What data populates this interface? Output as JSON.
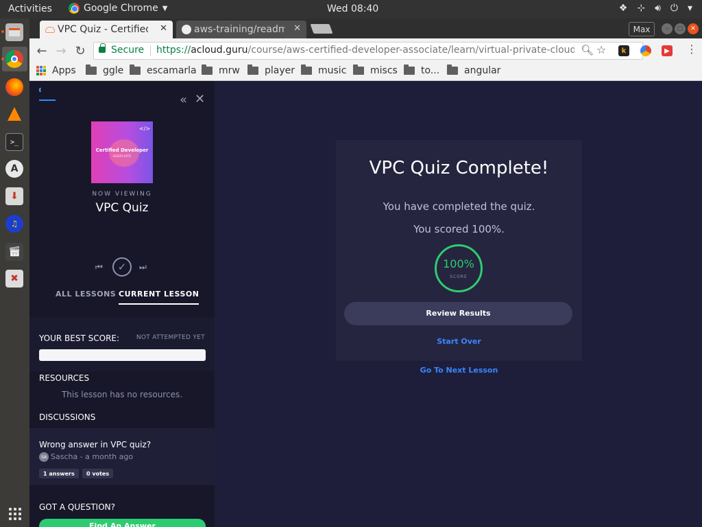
{
  "topbar": {
    "activities": "Activities",
    "app_name": "Google Chrome",
    "clock": "Wed 08:40"
  },
  "chrome": {
    "tabs": [
      {
        "title": "VPC Quiz - Certified",
        "active": true
      },
      {
        "title": "aws-training/readme",
        "active": false
      }
    ],
    "max_label": "Max",
    "secure_label": "Secure",
    "url_scheme": "https://",
    "url_host": "acloud.guru",
    "url_path": "/course/aws-certified-developer-associate/learn/virtual-private-cloud/quiz/..."
  },
  "bookmarks": [
    {
      "label": "Apps",
      "icon": "apps-grid-icon"
    },
    {
      "label": "ggle",
      "icon": "folder-icon"
    },
    {
      "label": "escamarla",
      "icon": "folder-icon"
    },
    {
      "label": "mrw",
      "icon": "folder-icon"
    },
    {
      "label": "player",
      "icon": "folder-icon"
    },
    {
      "label": "music",
      "icon": "folder-icon"
    },
    {
      "label": "miscs",
      "icon": "folder-icon"
    },
    {
      "label": "to...",
      "icon": "folder-icon"
    },
    {
      "label": "angular",
      "icon": "folder-icon"
    }
  ],
  "sidebar": {
    "thumbnail_title": "Certified Developer",
    "thumbnail_subtitle": "ASSOCIATE",
    "now_viewing_label": "NOW VIEWING",
    "lesson_title": "VPC Quiz",
    "tab_all": "ALL LESSONS",
    "tab_current": "CURRENT LESSON",
    "best_score_label": "YOUR BEST SCORE:",
    "best_score_status": "NOT ATTEMPTED YET",
    "best_score_fraction": 0,
    "resources_heading": "RESOURCES",
    "resources_empty": "This lesson has no resources.",
    "discussions_heading": "DISCUSSIONS",
    "discussion": {
      "question": "Wrong answer in VPC quiz?",
      "avatar_initials": "SA",
      "author_line": "Sascha - a month ago",
      "answers": "1 answers",
      "votes": "0 votes"
    },
    "got_question": "GOT A QUESTION?",
    "find_answer_label": "Find An Answer"
  },
  "quiz": {
    "heading": "VPC Quiz Complete!",
    "completed_text": "You have completed the quiz.",
    "score_text": "You scored 100%.",
    "score_value": "100%",
    "score_label": "SCORE",
    "review_button": "Review Results",
    "start_over": "Start Over",
    "next_lesson": "Go To Next Lesson"
  },
  "colors": {
    "accent_green": "#2ecc71",
    "link_blue": "#3a86ff",
    "page_bg": "#1e1e3b",
    "sidebar_bg": "#171729"
  }
}
